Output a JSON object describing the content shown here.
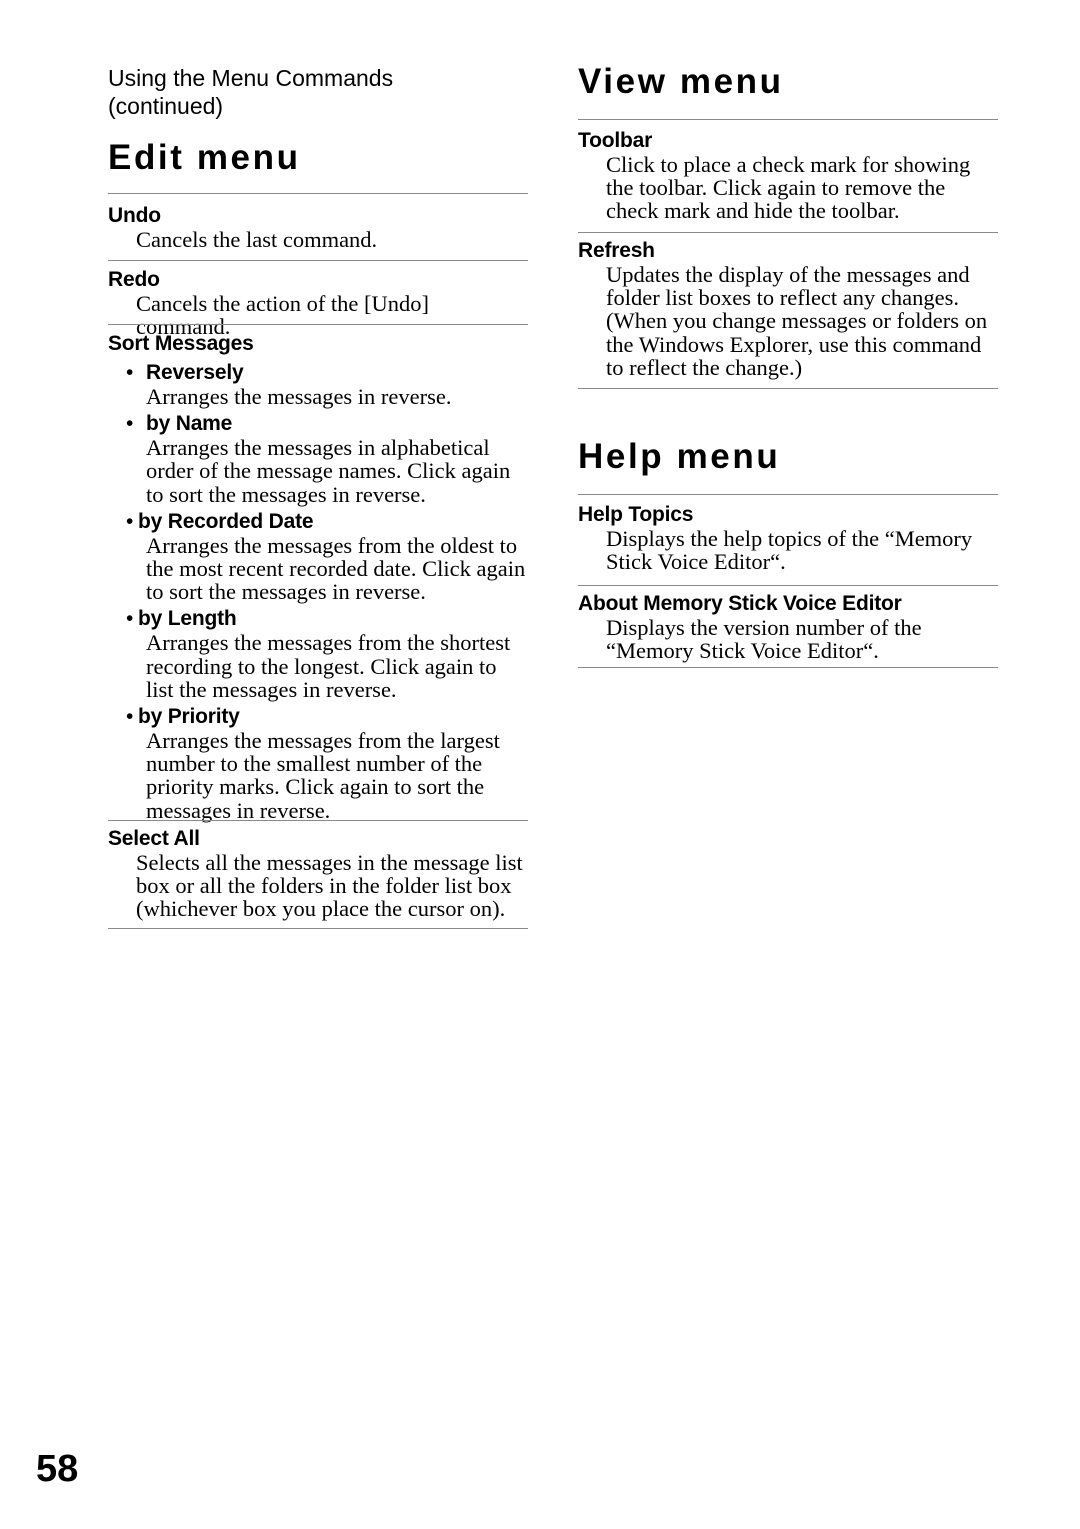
{
  "page": {
    "number": "58",
    "running_head_line1": "Using the Menu Commands",
    "running_head_line2": "(continued)"
  },
  "left_column": {
    "section_title": "Edit menu",
    "entries": [
      {
        "heading": "Undo",
        "body": "Cancels the last command."
      },
      {
        "heading": "Redo",
        "body": "Cancels the action of the [Undo] command."
      },
      {
        "heading": "Sort Messages",
        "bullets": [
          {
            "marker": "•",
            "label": "Reversely",
            "body": "Arranges the messages in reverse."
          },
          {
            "marker": "•",
            "label": "by Name",
            "body": "Arranges the messages in alphabetical order of the message names. Click again to sort the messages in reverse."
          },
          {
            "marker": "•",
            "label": "by Recorded Date",
            "body": "Arranges the messages from the oldest to the most recent recorded date. Click again to sort the messages in reverse."
          },
          {
            "marker": "•",
            "label": "by Length",
            "body": "Arranges the messages from the shortest recording to the longest. Click again to list the messages in reverse."
          },
          {
            "marker": "•",
            "label": "by Priority",
            "body": "Arranges the messages from the largest number to the smallest number of the priority marks. Click again to sort the messages in reverse."
          }
        ]
      },
      {
        "heading": "Select All",
        "body": "Selects all the messages in the message list box or all the folders in the folder list box (whichever box you place the cursor on)."
      }
    ]
  },
  "right_column": {
    "sections": [
      {
        "section_title": "View menu",
        "entries": [
          {
            "heading": "Toolbar",
            "body": "Click to place a check mark for showing the toolbar.  Click again to remove the check mark and hide the toolbar."
          },
          {
            "heading": "Refresh",
            "body": "Updates the display of the messages and folder list boxes to reflect any changes. (When you change messages or folders on the Windows Explorer, use this command to reflect the change.)"
          }
        ]
      },
      {
        "section_title": "Help menu",
        "entries": [
          {
            "heading": "Help Topics",
            "body": "Displays the help topics of the “Memory Stick Voice Editor“."
          },
          {
            "heading": "About Memory Stick Voice Editor",
            "body": "Displays the version number of the “Memory Stick Voice Editor“."
          }
        ]
      }
    ]
  }
}
